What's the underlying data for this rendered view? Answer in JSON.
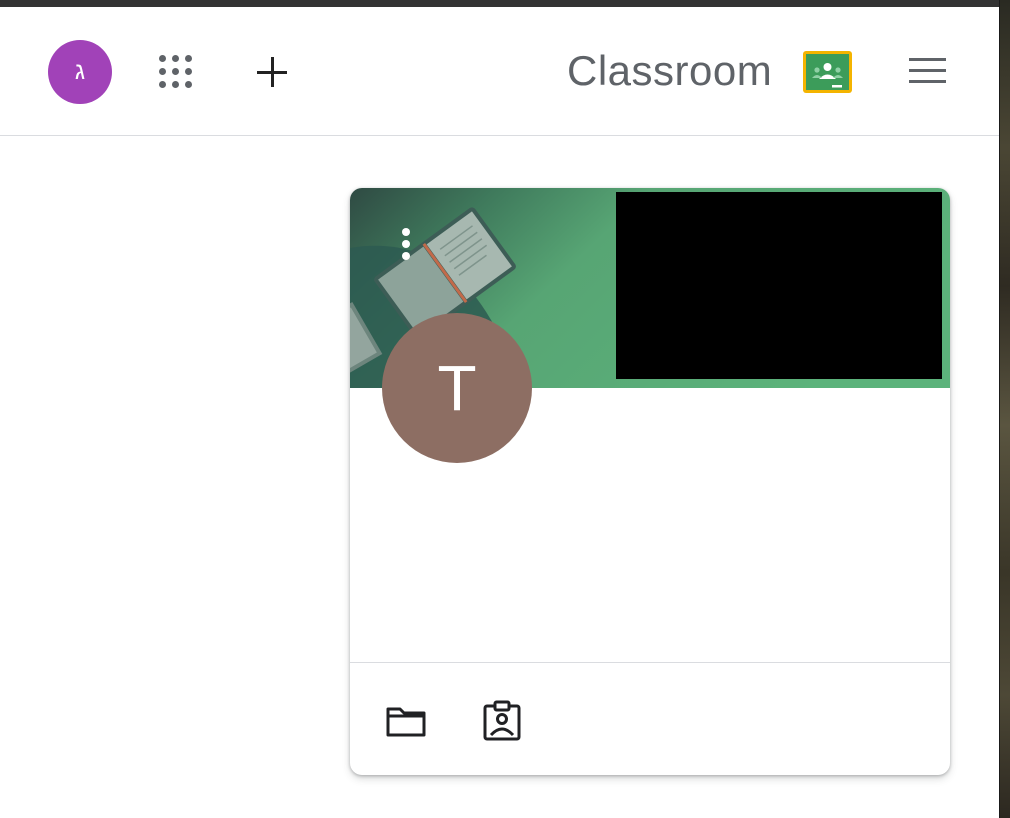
{
  "header": {
    "account_initial": "ג",
    "brand": "Classroom",
    "icons": {
      "apps": "apps-grid-icon",
      "add": "plus-icon",
      "logo": "classroom-logo-icon",
      "menu": "hamburger-menu-icon"
    }
  },
  "class_card": {
    "teacher_initial": "T",
    "icons": {
      "more": "more-vertical-icon",
      "folder": "folder-icon",
      "work": "assigned-work-icon"
    }
  },
  "colors": {
    "account_avatar": "#a142b8",
    "teacher_avatar": "#8d6e63",
    "banner_green": "#57a574",
    "logo_board": "#3c9c5a",
    "logo_frame": "#f4b400"
  }
}
